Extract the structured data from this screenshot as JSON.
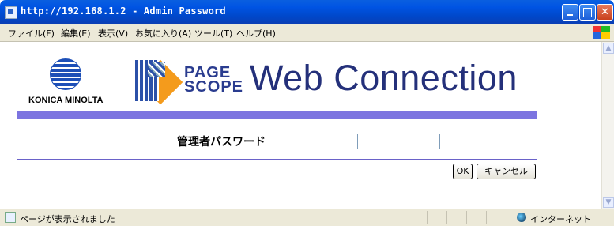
{
  "window": {
    "title": "http://192.168.1.2 - Admin Password",
    "buttons": {
      "minimize": "minimize",
      "maximize": "maximize",
      "close": "close"
    }
  },
  "menu": [
    {
      "label": "ファイル(F)"
    },
    {
      "label": "編集(E)"
    },
    {
      "label": "表示(V)"
    },
    {
      "label": "お気に入り(A)"
    },
    {
      "label": "ツール(T)"
    },
    {
      "label": "ヘルプ(H)"
    }
  ],
  "brand": {
    "konica_minolta": "KONICA MINOLTA",
    "page_scope_line1": "PAGE",
    "page_scope_line2": "SCOPE",
    "product": "Web Connection"
  },
  "form": {
    "label": "管理者パスワード",
    "password_value": "",
    "ok_label": "OK",
    "cancel_label": "キャンセル"
  },
  "status": {
    "message": "ページが表示されました",
    "zone": "インターネット"
  },
  "colors": {
    "titlebar": "#0054e3",
    "accent_bar": "#7c74e0",
    "brand_text": "#24307a"
  },
  "icons": [
    "ie-page-icon",
    "windows-flag-icon",
    "internet-globe-icon"
  ]
}
